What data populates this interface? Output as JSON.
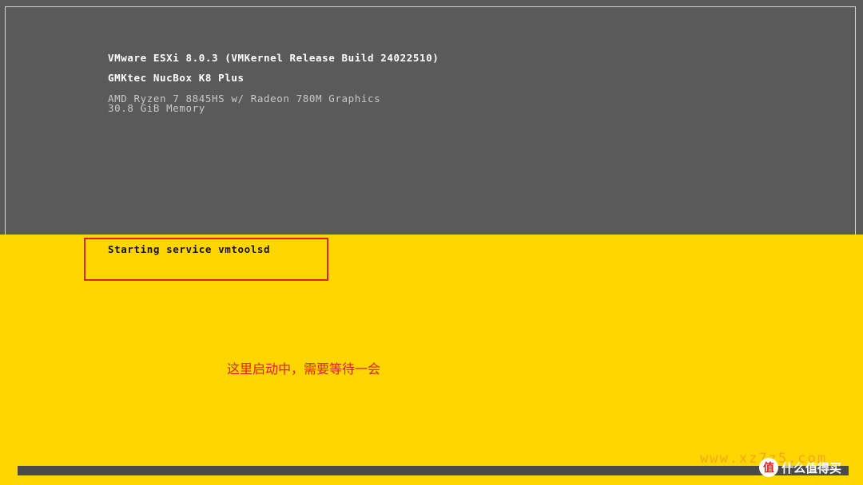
{
  "boot_screen": {
    "version_line": "VMware ESXi 8.0.3 (VMKernel Release Build 24022510)",
    "model_line": "GMKtec NucBox K8 Plus",
    "cpu_line": "AMD Ryzen 7 8845HS w/ Radeon 780M Graphics",
    "memory_line": "30.8 GiB Memory",
    "status_line": "Starting service vmtoolsd",
    "progress_fraction": 1.0
  },
  "annotation": {
    "text": "这里启动中，需要等待一会"
  },
  "watermark": {
    "url": "www.xz7z5.com",
    "brand_text": "什么值得买",
    "brand_badge": "值"
  },
  "colors": {
    "top_panel": "#5a5a5a",
    "bottom_panel": "#ffd600",
    "highlight": "#e02020",
    "progress": "#4a4a4a"
  }
}
